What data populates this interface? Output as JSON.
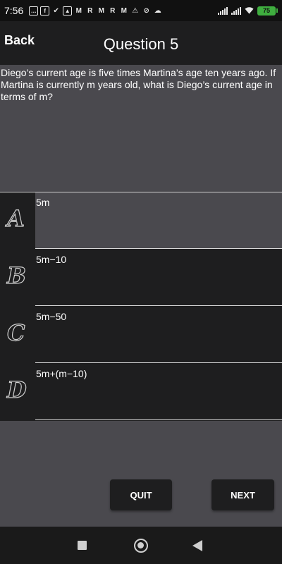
{
  "status_bar": {
    "time": "7:56",
    "battery": "75",
    "left_icons": [
      "chat-icon",
      "facebook-icon",
      "check-icon",
      "gallery-icon",
      "gmail-icon",
      "r-icon",
      "gmail-icon",
      "r-icon",
      "gmail-icon",
      "warning-icon",
      "blocked-icon",
      "cloud-icon"
    ],
    "right_icons": [
      "signal-icon",
      "signal-icon",
      "wifi-icon",
      "battery-icon"
    ]
  },
  "header": {
    "back_label": "Back",
    "title": "Question 5"
  },
  "question": {
    "text": "Diego’s current age is five times Martina’s age ten years ago. If Martina is currently m years old, what is Diego’s current age in terms of m?"
  },
  "answers": [
    {
      "letter": "A",
      "text": "5m",
      "selected": true
    },
    {
      "letter": "B",
      "text": "5m−10",
      "selected": false
    },
    {
      "letter": "C",
      "text": "5m−50",
      "selected": false
    },
    {
      "letter": "D",
      "text": "5m+(m−10)",
      "selected": false
    }
  ],
  "buttons": {
    "quit_label": "QUIT",
    "next_label": "NEXT"
  },
  "colors": {
    "dark": "#1e1e1f",
    "panel": "#4a494e",
    "battery": "#3fae3f"
  }
}
